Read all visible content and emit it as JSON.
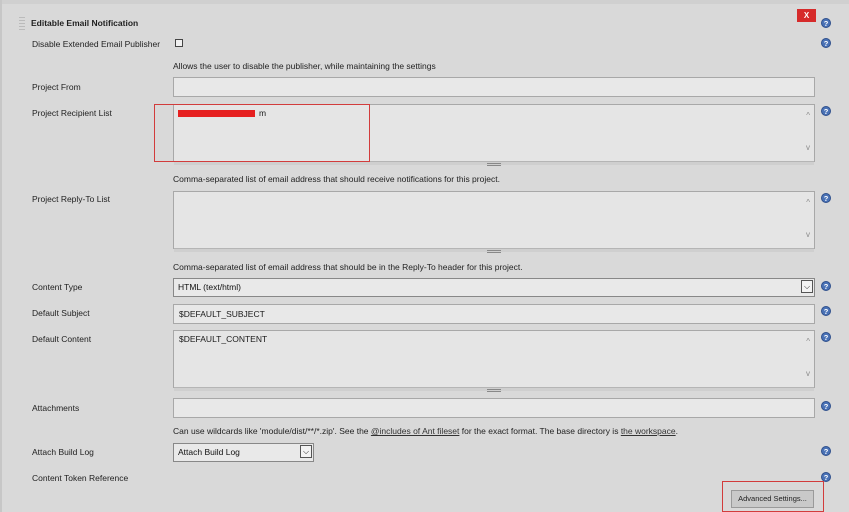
{
  "section": {
    "title": "Editable Email Notification",
    "close_label": "X"
  },
  "disable_publisher": {
    "label": "Disable Extended Email Publisher",
    "description": "Allows the user to disable the publisher, while maintaining the settings",
    "checked": false
  },
  "project_from": {
    "label": "Project From",
    "value": ""
  },
  "recipient_list": {
    "label": "Project Recipient List",
    "value": "m",
    "description": "Comma-separated list of email address that should receive notifications for this project."
  },
  "reply_to": {
    "label": "Project Reply-To List",
    "value": "",
    "description": "Comma-separated list of email address that should be in the Reply-To header for this project."
  },
  "content_type": {
    "label": "Content Type",
    "value": "HTML (text/html)"
  },
  "default_subject": {
    "label": "Default Subject",
    "value": "$DEFAULT_SUBJECT"
  },
  "default_content": {
    "label": "Default Content",
    "value": "$DEFAULT_CONTENT"
  },
  "attachments": {
    "label": "Attachments",
    "value": "",
    "desc_pre": "Can use wildcards like 'module/dist/**/*.zip'. See the ",
    "desc_link1": "@includes of Ant fileset",
    "desc_mid": " for the exact format. The base directory is ",
    "desc_link2": "the workspace",
    "desc_post": "."
  },
  "attach_build_log": {
    "label": "Attach Build Log",
    "value": "Attach Build Log"
  },
  "content_token": {
    "label": "Content Token Reference"
  },
  "advanced_button": {
    "label": "Advanced Settings..."
  },
  "help_glyph": "?",
  "icons": {
    "help": "question-help-icon",
    "close": "close-icon",
    "dropdown": "chevron-down-icon",
    "scroll_up": "scroll-up-arrow-icon",
    "scroll_down": "scroll-down-arrow-icon"
  },
  "colors": {
    "help_icon": "#4a72b6",
    "close": "#d62b2b",
    "highlight_box": "#d23c3c",
    "redaction": "#e62020"
  }
}
